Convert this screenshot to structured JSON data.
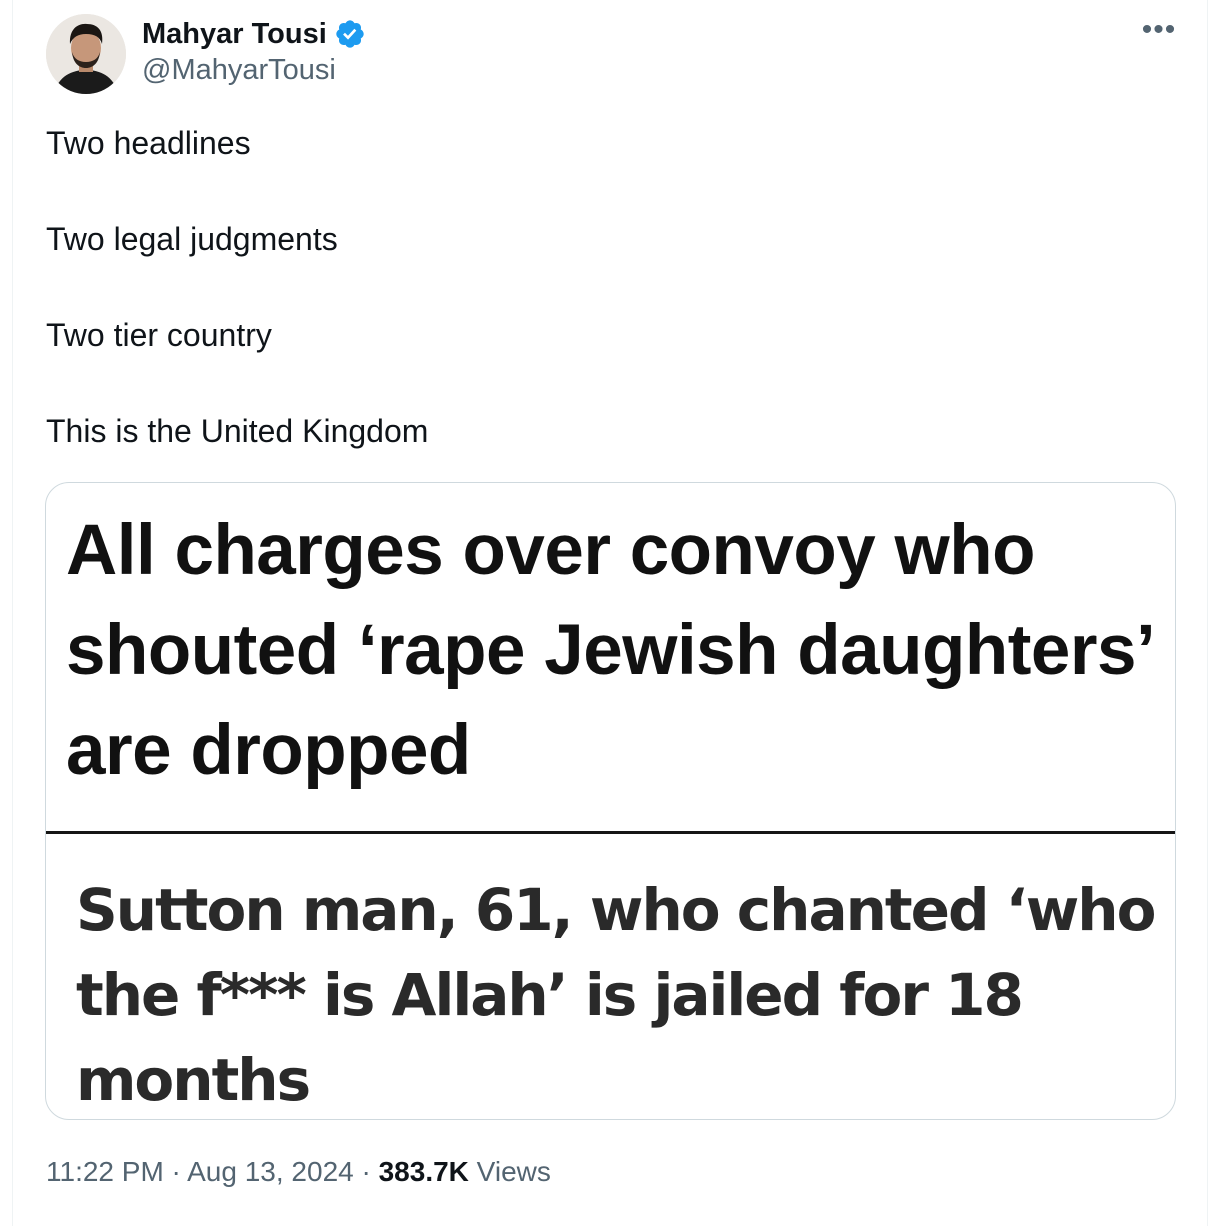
{
  "tweet": {
    "author": {
      "name": "Mahyar Tousi",
      "handle": "@MahyarTousi",
      "verified": true
    },
    "more_label": "•••",
    "text_lines": [
      "Two headlines",
      "Two legal judgments",
      "Two tier country",
      "This is the United Kingdom"
    ],
    "media": {
      "headline_top": "All charges over convoy who shouted ‘rape Jewish daughters’ are dropped",
      "headline_bottom": "Sutton man, 61, who chanted ‘who the f*** is Allah’ is jailed for 18 months"
    },
    "meta": {
      "time": "11:22 PM",
      "separator": " · ",
      "date": "Aug 13, 2024",
      "views_count": "383.7K",
      "views_label": " Views"
    }
  },
  "colors": {
    "verified_badge": "#1d9bf0",
    "secondary_text": "#536471",
    "primary_text": "#0f1419",
    "media_border": "#cfd9de"
  },
  "icons": {
    "verified": "verified-badge-icon",
    "more": "more-options-icon"
  }
}
